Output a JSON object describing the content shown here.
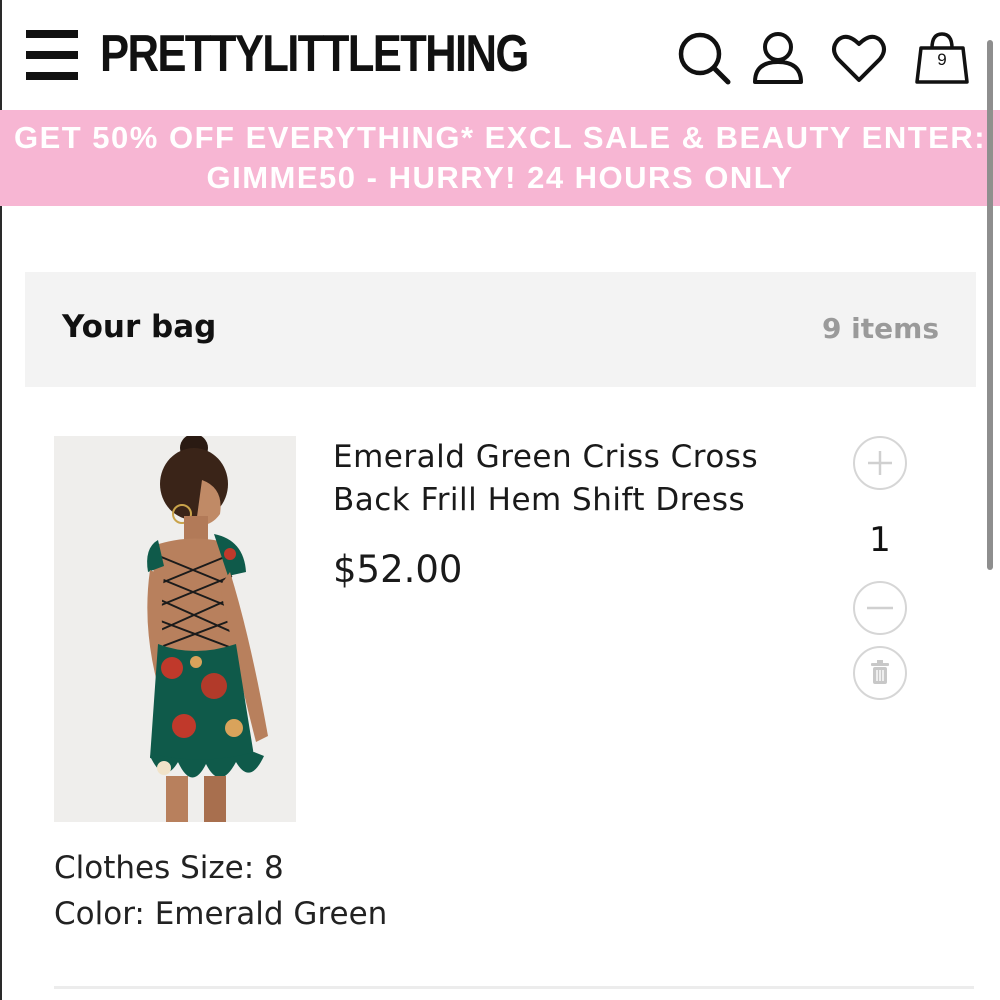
{
  "header": {
    "brand": "PRETTYLITTLETHING",
    "bag_count": "9",
    "icons": [
      "menu-icon",
      "search-icon",
      "account-icon",
      "wishlist-heart-icon",
      "shopping-bag-icon"
    ]
  },
  "promo": {
    "line1": "GET 50% OFF EVERYTHING* EXCL SALE & BEAUTY ENTER:",
    "line2": "GIMME50 - HURRY! 24 HOURS ONLY",
    "background": "#f7b6d3",
    "text_color": "#ffffff"
  },
  "bag": {
    "title": "Your bag",
    "count_text": "9 items"
  },
  "product": {
    "name": "Emerald Green Criss Cross Back Frill Hem Shift Dress",
    "price": "$52.00",
    "quantity": "1",
    "size_text": "Clothes Size: 8",
    "color_text": "Color: Emerald Green",
    "icons": [
      "plus-icon",
      "minus-icon",
      "trash-icon"
    ]
  },
  "colors": {
    "brand_pink": "#f7b6d3",
    "panel_gray": "#f3f3f3",
    "muted_text": "#9a9a9a",
    "dress_green": "#0f5a4a"
  }
}
